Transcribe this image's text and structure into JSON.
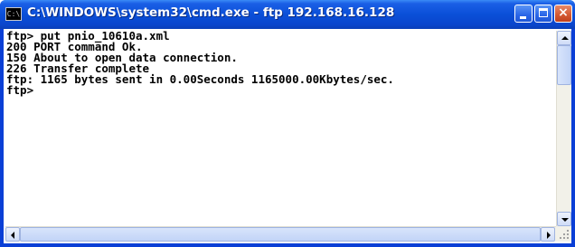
{
  "window": {
    "title": "C:\\WINDOWS\\system32\\cmd.exe - ftp 192.168.16.128",
    "icon_name": "console-icon",
    "icon_text": "C:\\",
    "accent_color": "#0a4fd8",
    "close_color": "#d55a34"
  },
  "console": {
    "lines": [
      "ftp> put pnio_10610a.xml",
      "200 PORT command Ok.",
      "150 About to open data connection.",
      "226 Transfer complete",
      "ftp: 1165 bytes sent in 0.00Seconds 1165000.00Kbytes/sec.",
      "ftp>"
    ]
  }
}
